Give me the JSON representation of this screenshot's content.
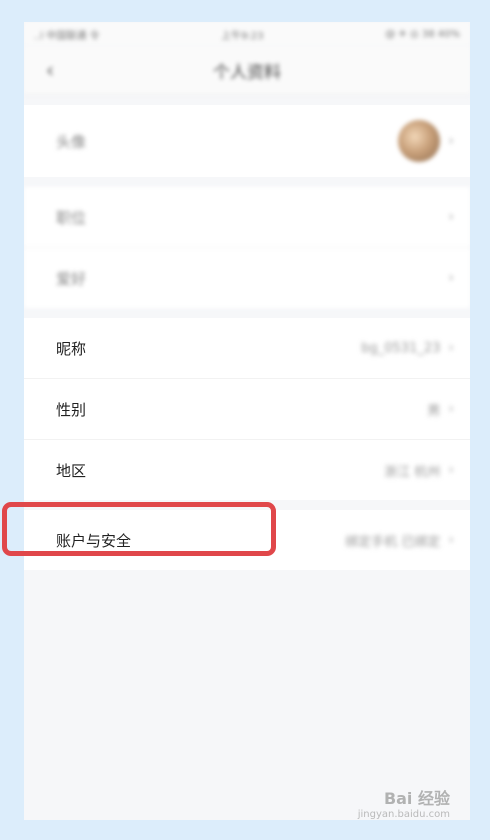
{
  "statusbar": {
    "carrier": "..l 中国联通 令",
    "time": "上午9:23",
    "battery": "@ ✈ ◎ 38 40%"
  },
  "nav": {
    "back_icon": "chevron-left-icon",
    "title": "个人资料"
  },
  "group1": {
    "avatar_label": "头像"
  },
  "group2": {
    "item1_label": "职位",
    "item2_label": "爱好"
  },
  "group3": {
    "nickname_label": "昵称",
    "nickname_value": "bg_0531_23",
    "gender_label": "性别",
    "gender_value": "男",
    "region_label": "地区",
    "region_value": "浙江 杭州"
  },
  "group4": {
    "account_label": "账户与安全",
    "account_value": "绑定手机 已绑定"
  },
  "chevron": "›",
  "watermark": {
    "main": "Bai 经验",
    "sub": "jingyan.baidu.com"
  },
  "colors": {
    "highlight": "#e0474a",
    "page_bg": "#dcedfb"
  }
}
